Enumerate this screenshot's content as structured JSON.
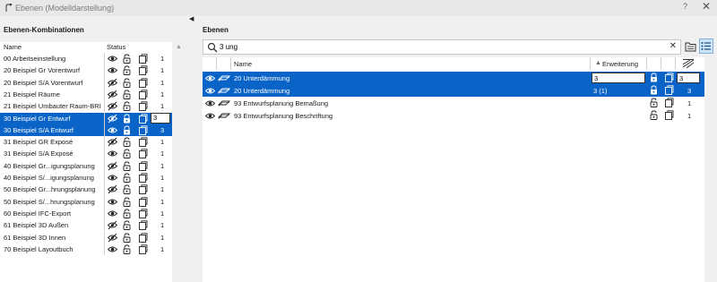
{
  "window": {
    "title": "Ebenen (Modelldarstellung)",
    "help": "?",
    "close": "✕"
  },
  "left": {
    "title": "Ebenen-Kombinationen",
    "col_name": "Name",
    "col_status": "Status",
    "edit_value": "3",
    "rows": [
      {
        "name": "00 Arbeitseinstellung",
        "num": "1",
        "eye": "open",
        "sel": false
      },
      {
        "name": "20 Beispiel Gr Vorentwurf",
        "num": "1",
        "eye": "open",
        "sel": false
      },
      {
        "name": "20 Beispiel S/A Vorentwurf",
        "num": "1",
        "eye": "closed",
        "sel": false
      },
      {
        "name": "21 Beispiel Räume",
        "num": "1",
        "eye": "closed",
        "sel": false
      },
      {
        "name": "21 Beispiel Umbauter Raum-BRI",
        "num": "1",
        "eye": "closed",
        "sel": false
      },
      {
        "name": "30 Beispiel Gr Entwurf",
        "num": "",
        "eye": "closed",
        "sel": true
      },
      {
        "name": "30 Beispiel S/A Entwurf",
        "num": "3",
        "eye": "open",
        "sel": true
      },
      {
        "name": "31 Beispiel GR Exposé",
        "num": "1",
        "eye": "closed",
        "sel": false
      },
      {
        "name": "31 Beispiel S/A Exposé",
        "num": "1",
        "eye": "open",
        "sel": false
      },
      {
        "name": "40 Beispiel Gr...igungsplanung",
        "num": "1",
        "eye": "closed",
        "sel": false
      },
      {
        "name": "40 Beispiel S/...igungsplanung",
        "num": "1",
        "eye": "open",
        "sel": false
      },
      {
        "name": "50 Beispiel Gr...hrungsplanung",
        "num": "1",
        "eye": "closed",
        "sel": false
      },
      {
        "name": "50 Beispiel S/...hrungsplanung",
        "num": "1",
        "eye": "open",
        "sel": false
      },
      {
        "name": "60 Beispiel IFC-Export",
        "num": "1",
        "eye": "open",
        "sel": false
      },
      {
        "name": "61 Beispiel 3D Außen",
        "num": "1",
        "eye": "closed",
        "sel": false
      },
      {
        "name": "61 Beispiel 3D Innen",
        "num": "1",
        "eye": "closed",
        "sel": false
      },
      {
        "name": "70 Beispiel Layoutbuch",
        "num": "1",
        "eye": "open",
        "sel": false
      }
    ]
  },
  "right": {
    "title": "Ebenen",
    "search": {
      "value": "3 ung"
    },
    "col_name": "Name",
    "col_ext": "Erweiterung",
    "rows": [
      {
        "name": "20 Unterdämmung",
        "ext": "",
        "num": "",
        "sel": true,
        "editing": true,
        "ext_edit": "3",
        "num_edit": "3"
      },
      {
        "name": "20 Unterdämmung",
        "ext": "3 (1)",
        "num": "3",
        "sel": true,
        "editing": false
      },
      {
        "name": "93 Entwurfsplanung Bemaßung",
        "ext": "",
        "num": "1",
        "sel": false,
        "editing": false
      },
      {
        "name": "93 Entwurfsplanung Beschriftung",
        "ext": "",
        "num": "1",
        "sel": false,
        "editing": false
      }
    ]
  }
}
